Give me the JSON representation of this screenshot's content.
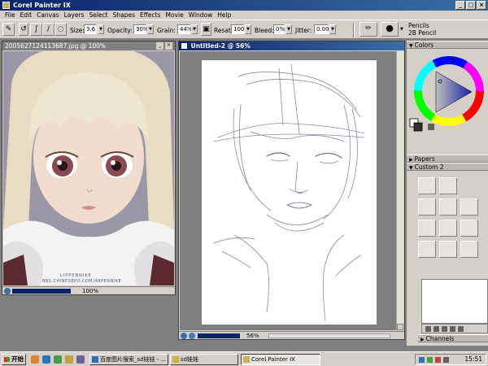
{
  "window": {
    "title": "Corel Painter IX"
  },
  "menu": [
    "File",
    "Edit",
    "Canvas",
    "Layers",
    "Select",
    "Shapes",
    "Effects",
    "Movie",
    "Window",
    "Help"
  ],
  "propbar": {
    "size_label": "Size:",
    "size_value": "3.6",
    "opacity_label": "Opacity:",
    "opacity_value": "30%",
    "grain_label": "Grain:",
    "grain_value": "44%",
    "resat_label": "Resat:",
    "resat_value": "100",
    "bleed_label": "Bleed:",
    "bleed_value": "0%",
    "jitter_label": "Jitter:",
    "jitter_value": "0.00"
  },
  "brush": {
    "category": "Pencils",
    "variant": "2B Pencil"
  },
  "photo_doc": {
    "title": "2005627124113687.jpg @ 100%",
    "zoom": "100%",
    "watermark_line1": "LIPPENNIKE",
    "watermark_line2": "BBS.CHINESEPO.COM/ARPENNIKE"
  },
  "canvas_doc": {
    "title": "Untitled-2 @ 56%",
    "zoom": "56%"
  },
  "panels": {
    "colors": "Colors",
    "papers": "Papers",
    "custom": "Custom 2",
    "channels": "Channels"
  },
  "taskbar": {
    "start": "开始",
    "tasks": [
      "百度图片搜索_sd娃娃 - ...",
      "sd娃娃",
      "Corel Painter IX"
    ],
    "clock": "15:51"
  },
  "colors": {
    "titlebar": "#0a246a",
    "chrome": "#d4d0c8",
    "canvas_bg": "#7f7f7f"
  }
}
